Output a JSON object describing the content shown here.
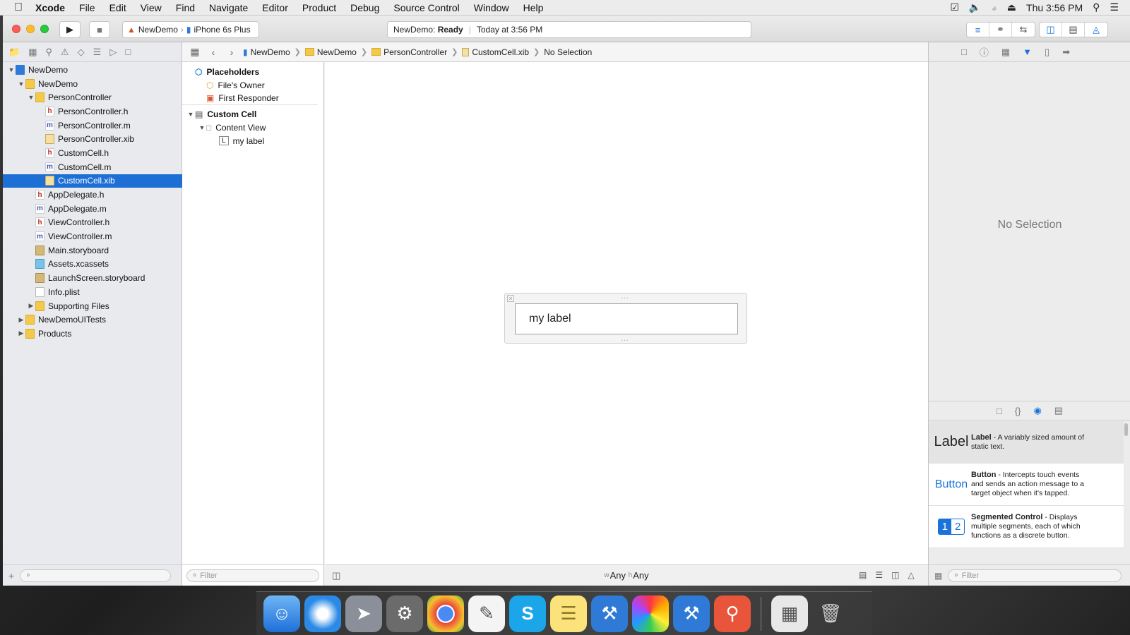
{
  "menubar": {
    "app": "Xcode",
    "items": [
      "File",
      "Edit",
      "View",
      "Find",
      "Navigate",
      "Editor",
      "Product",
      "Debug",
      "Source Control",
      "Window",
      "Help"
    ],
    "clock": "Thu 3:56 PM"
  },
  "toolbar": {
    "scheme": "NewDemo",
    "device": "iPhone 6s Plus",
    "status_project": "NewDemo:",
    "status_state": "Ready",
    "status_time": "Today at 3:56 PM"
  },
  "navigator": {
    "tree": [
      {
        "label": "NewDemo",
        "icon": "proj",
        "level": 0,
        "open": true
      },
      {
        "label": "NewDemo",
        "icon": "folder",
        "level": 1,
        "open": true
      },
      {
        "label": "PersonController",
        "icon": "folder",
        "level": 2,
        "open": true
      },
      {
        "label": "PersonController.h",
        "icon": "h",
        "level": 3
      },
      {
        "label": "PersonController.m",
        "icon": "m",
        "level": 3
      },
      {
        "label": "PersonController.xib",
        "icon": "xib",
        "level": 3
      },
      {
        "label": "CustomCell.h",
        "icon": "h",
        "level": 3
      },
      {
        "label": "CustomCell.m",
        "icon": "m",
        "level": 3
      },
      {
        "label": "CustomCell.xib",
        "icon": "xib",
        "level": 3,
        "selected": true
      },
      {
        "label": "AppDelegate.h",
        "icon": "h",
        "level": 2
      },
      {
        "label": "AppDelegate.m",
        "icon": "m",
        "level": 2
      },
      {
        "label": "ViewController.h",
        "icon": "h",
        "level": 2
      },
      {
        "label": "ViewController.m",
        "icon": "m",
        "level": 2
      },
      {
        "label": "Main.storyboard",
        "icon": "sb",
        "level": 2
      },
      {
        "label": "Assets.xcassets",
        "icon": "assets",
        "level": 2
      },
      {
        "label": "LaunchScreen.storyboard",
        "icon": "sb",
        "level": 2
      },
      {
        "label": "Info.plist",
        "icon": "plist",
        "level": 2
      },
      {
        "label": "Supporting Files",
        "icon": "folder",
        "level": 2,
        "closed": true
      },
      {
        "label": "NewDemoUITests",
        "icon": "folder",
        "level": 1,
        "closed": true
      },
      {
        "label": "Products",
        "icon": "folder",
        "level": 1,
        "closed": true
      }
    ]
  },
  "jumpbar": {
    "crumbs": [
      "NewDemo",
      "NewDemo",
      "PersonController",
      "CustomCell.xib"
    ],
    "tail": "No Selection"
  },
  "outline": {
    "placeholders": "Placeholders",
    "files_owner": "File's Owner",
    "first_responder": "First Responder",
    "custom_cell": "Custom Cell",
    "content_view": "Content View",
    "label_item": "my label",
    "filter_placeholder": "Filter"
  },
  "canvas": {
    "cell_label": "my label",
    "size_w_prefix": "w",
    "size_w": "Any",
    "size_h_prefix": "h",
    "size_h": "Any"
  },
  "inspector": {
    "no_selection": "No Selection",
    "filter_placeholder": "Filter"
  },
  "library": [
    {
      "preview": "Label",
      "title": "Label",
      "desc": " - A variably sized amount of static text."
    },
    {
      "preview": "Button",
      "title": "Button",
      "desc": " - Intercepts touch events and sends an action message to a target object when it's tapped."
    },
    {
      "preview": "seg",
      "title": "Segmented Control",
      "desc": " - Displays multiple segments, each of which functions as a discrete button."
    }
  ],
  "colors": {
    "selection": "#1d6fd6",
    "accent": "#1a73d9"
  }
}
